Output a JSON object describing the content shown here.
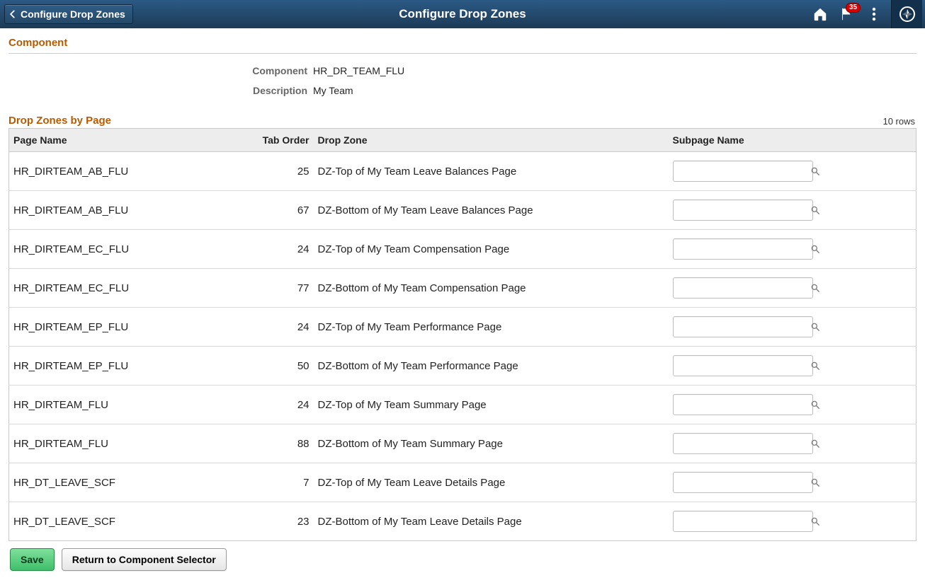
{
  "banner": {
    "back_label": "Configure Drop Zones",
    "title": "Configure Drop Zones",
    "notifications_count": "35"
  },
  "section": {
    "component_heading": "Component",
    "component_label": "Component",
    "component_value": "HR_DR_TEAM_FLU",
    "description_label": "Description",
    "description_value": "My Team",
    "dropzones_heading": "Drop Zones by Page",
    "rows_label": "10 rows"
  },
  "grid": {
    "headers": {
      "page_name": "Page Name",
      "tab_order": "Tab Order",
      "drop_zone": "Drop Zone",
      "subpage_name": "Subpage Name"
    },
    "rows": [
      {
        "page_name": "HR_DIRTEAM_AB_FLU",
        "tab_order": "25",
        "drop_zone": "DZ-Top of My Team Leave Balances Page",
        "subpage": ""
      },
      {
        "page_name": "HR_DIRTEAM_AB_FLU",
        "tab_order": "67",
        "drop_zone": "DZ-Bottom of My Team Leave Balances Page",
        "subpage": ""
      },
      {
        "page_name": "HR_DIRTEAM_EC_FLU",
        "tab_order": "24",
        "drop_zone": "DZ-Top of My Team Compensation Page",
        "subpage": ""
      },
      {
        "page_name": "HR_DIRTEAM_EC_FLU",
        "tab_order": "77",
        "drop_zone": "DZ-Bottom of My Team Compensation Page",
        "subpage": ""
      },
      {
        "page_name": "HR_DIRTEAM_EP_FLU",
        "tab_order": "24",
        "drop_zone": "DZ-Top of My Team Performance Page",
        "subpage": ""
      },
      {
        "page_name": "HR_DIRTEAM_EP_FLU",
        "tab_order": "50",
        "drop_zone": "DZ-Bottom of My Team Performance Page",
        "subpage": ""
      },
      {
        "page_name": "HR_DIRTEAM_FLU",
        "tab_order": "24",
        "drop_zone": "DZ-Top of My Team Summary Page",
        "subpage": ""
      },
      {
        "page_name": "HR_DIRTEAM_FLU",
        "tab_order": "88",
        "drop_zone": "DZ-Bottom of My Team Summary Page",
        "subpage": ""
      },
      {
        "page_name": "HR_DT_LEAVE_SCF",
        "tab_order": "7",
        "drop_zone": "DZ-Top of My Team Leave Details Page",
        "subpage": ""
      },
      {
        "page_name": "HR_DT_LEAVE_SCF",
        "tab_order": "23",
        "drop_zone": "DZ-Bottom of My Team Leave Details Page",
        "subpage": ""
      }
    ]
  },
  "footer": {
    "save_label": "Save",
    "return_label": "Return to Component Selector"
  }
}
